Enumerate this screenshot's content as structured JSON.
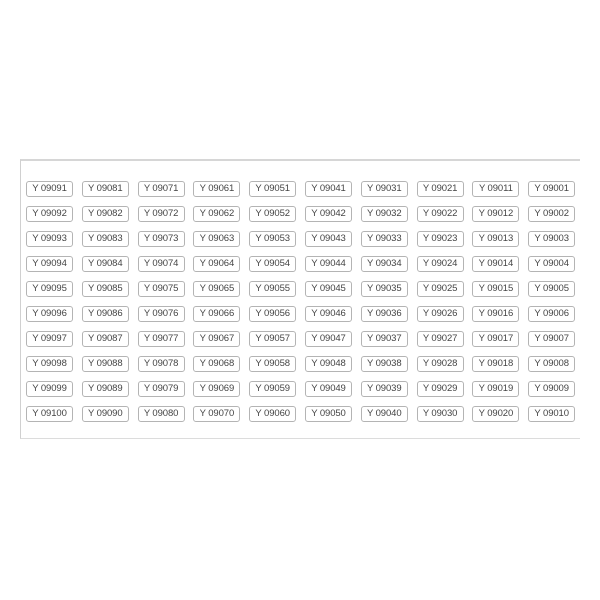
{
  "sheet": {
    "prefix": "Y",
    "columns": 10,
    "rows": 10,
    "labels": [
      [
        "Y 09091",
        "Y 09081",
        "Y 09071",
        "Y 09061",
        "Y 09051",
        "Y 09041",
        "Y 09031",
        "Y 09021",
        "Y 09011",
        "Y 09001"
      ],
      [
        "Y 09092",
        "Y 09082",
        "Y 09072",
        "Y 09062",
        "Y 09052",
        "Y 09042",
        "Y 09032",
        "Y 09022",
        "Y 09012",
        "Y 09002"
      ],
      [
        "Y 09093",
        "Y 09083",
        "Y 09073",
        "Y 09063",
        "Y 09053",
        "Y 09043",
        "Y 09033",
        "Y 09023",
        "Y 09013",
        "Y 09003"
      ],
      [
        "Y 09094",
        "Y 09084",
        "Y 09074",
        "Y 09064",
        "Y 09054",
        "Y 09044",
        "Y 09034",
        "Y 09024",
        "Y 09014",
        "Y 09004"
      ],
      [
        "Y 09095",
        "Y 09085",
        "Y 09075",
        "Y 09065",
        "Y 09055",
        "Y 09045",
        "Y 09035",
        "Y 09025",
        "Y 09015",
        "Y 09005"
      ],
      [
        "Y 09096",
        "Y 09086",
        "Y 09076",
        "Y 09066",
        "Y 09056",
        "Y 09046",
        "Y 09036",
        "Y 09026",
        "Y 09016",
        "Y 09006"
      ],
      [
        "Y 09097",
        "Y 09087",
        "Y 09077",
        "Y 09067",
        "Y 09057",
        "Y 09047",
        "Y 09037",
        "Y 09027",
        "Y 09017",
        "Y 09007"
      ],
      [
        "Y 09098",
        "Y 09088",
        "Y 09078",
        "Y 09068",
        "Y 09058",
        "Y 09048",
        "Y 09038",
        "Y 09028",
        "Y 09018",
        "Y 09008"
      ],
      [
        "Y 09099",
        "Y 09089",
        "Y 09079",
        "Y 09069",
        "Y 09059",
        "Y 09049",
        "Y 09039",
        "Y 09029",
        "Y 09019",
        "Y 09009"
      ],
      [
        "Y 09100",
        "Y 09090",
        "Y 09080",
        "Y 09070",
        "Y 09060",
        "Y 09050",
        "Y 09040",
        "Y 09030",
        "Y 09020",
        "Y 09010"
      ]
    ]
  },
  "colors": {
    "label_border": "#b4b4b4",
    "label_text": "#444444",
    "sheet_border": "#d6d6d6",
    "background": "#ffffff"
  }
}
